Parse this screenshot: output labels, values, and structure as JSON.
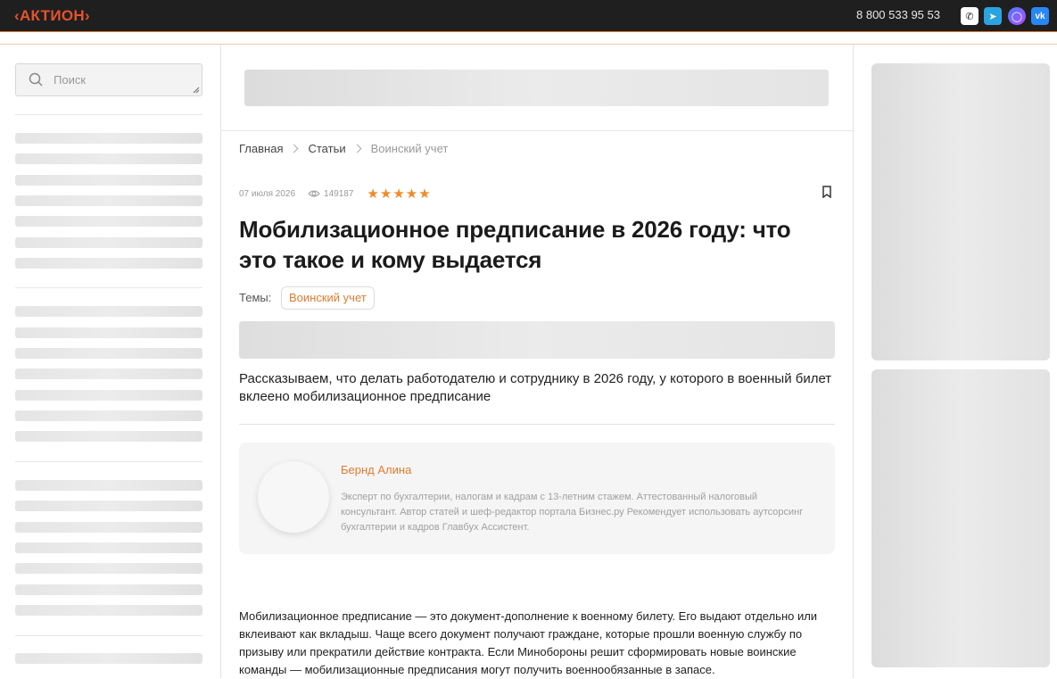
{
  "header": {
    "logo": "‹АКТИОН›",
    "phone": "8 800 533 95 53",
    "social": [
      {
        "name": "phone-icon",
        "glyph": "✆"
      },
      {
        "name": "telegram-icon",
        "glyph": "➤"
      },
      {
        "name": "max-icon",
        "glyph": "◯"
      },
      {
        "name": "vk-icon",
        "glyph": "vk"
      }
    ]
  },
  "sidebar": {
    "search_placeholder": "Поиск"
  },
  "breadcrumbs": [
    "Главная",
    "Статьи",
    "Воинский учет"
  ],
  "article": {
    "date": "07 июля 2026",
    "views": "149187",
    "rating_stars": "★★★★★",
    "rating_value": 5,
    "title": "Мобилизационное предписание в 2026 году: что это такое и кому выдается",
    "topics_label": "Темы:",
    "topic_tag": "Воинский учет",
    "lead": "Рассказываем, что делать работодателю и сотруднику в 2026 году, у которого в военный билет вклеено мобилизационное предписание",
    "author": {
      "name": "Бернд Алина",
      "bio": "Эксперт по бухгалтерии, налогам и кадрам с 13-летним стажем. Аттестованный налоговый консультант. Автор статей и шеф-редактор портала Бизнес.ру Рекомендует использовать аутсорсинг бухгалтерии и кадров Главбух Ассистент."
    },
    "body": "Мобилизационное предписание —  это документ-дополнение к военному билету. Его выдают отдельно или вклеивают как вкладыш. Чаще всего документ получают граждане, которые прошли военную службу по призыву или прекратили действие контракта. Если Минобороны решит сформировать новые воинские команды — мобилизационные предписания могут получить военнообязанные в запасе."
  },
  "colors": {
    "accent": "#e07b2f",
    "topbar": "#1f1f1f",
    "logo": "#e4532c"
  }
}
